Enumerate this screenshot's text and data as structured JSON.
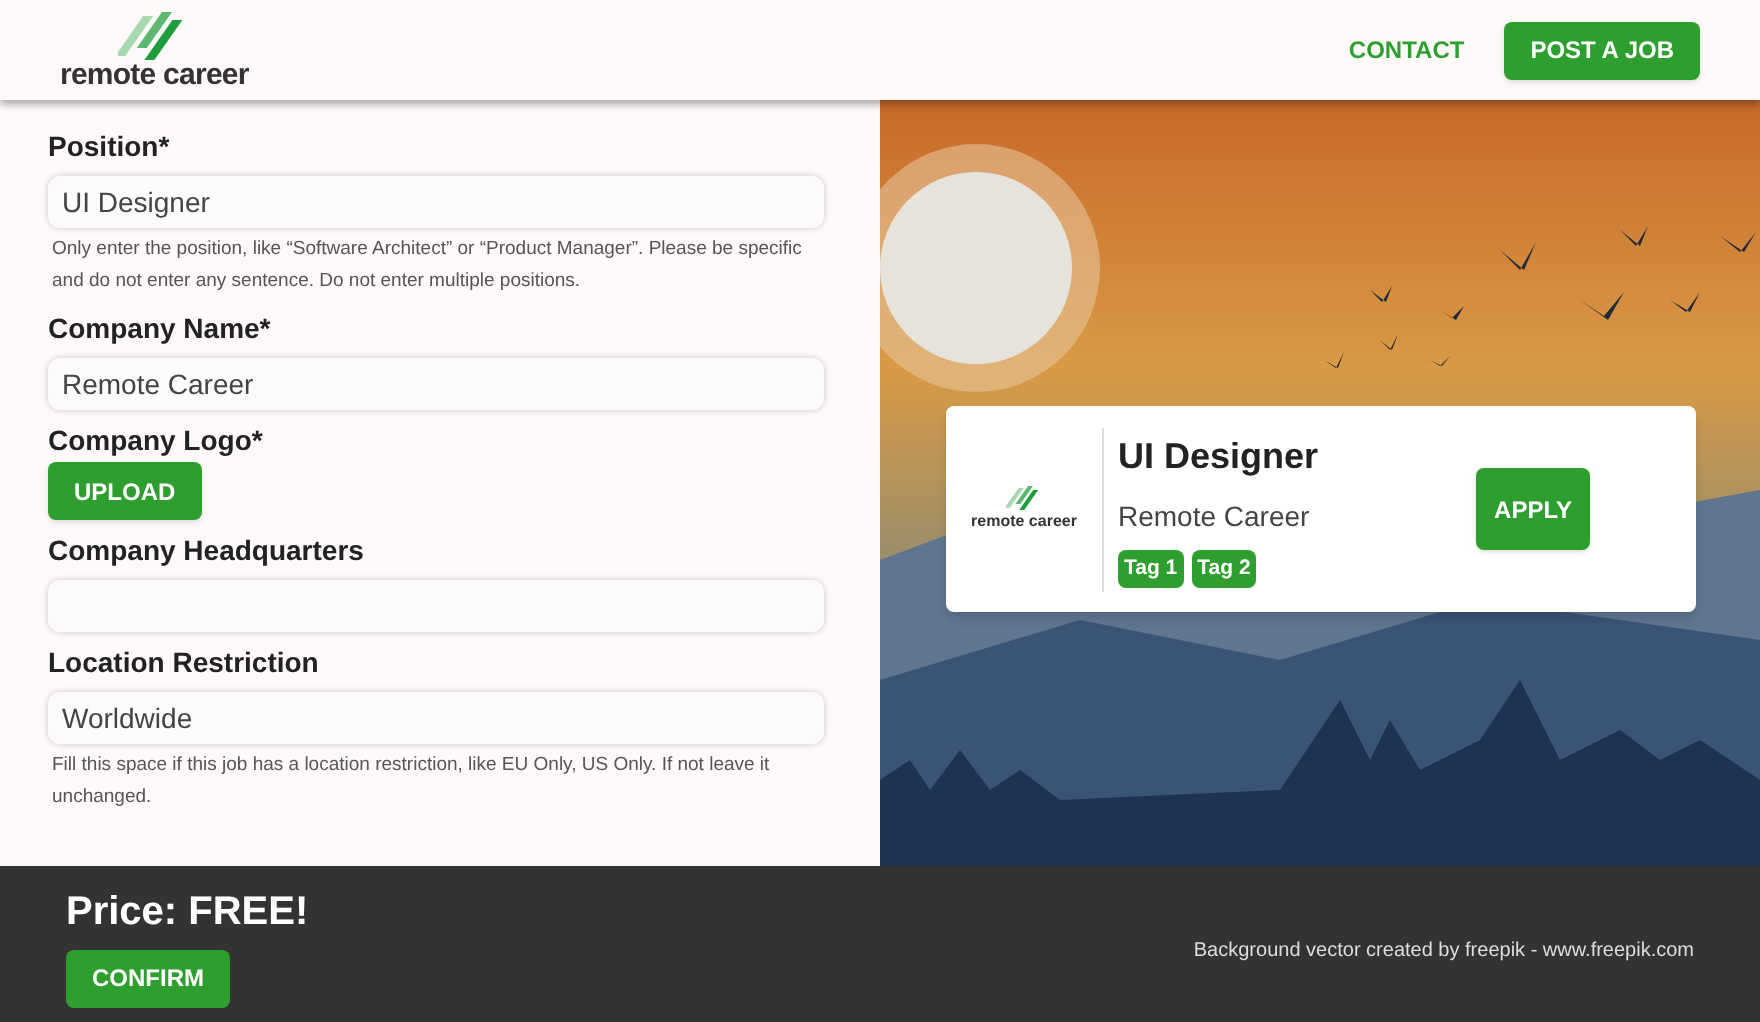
{
  "header": {
    "logo_text": "remote career",
    "nav": [
      {
        "label": "CONTACT",
        "kind": "link"
      },
      {
        "label": "POST A JOB",
        "kind": "button"
      }
    ]
  },
  "form": {
    "fields": [
      {
        "kind": "text",
        "label": "Position*",
        "value": "UI Designer",
        "help": "Only enter the position, like “Software Architect” or “Product Manager”. Please be specific and do not enter any sentence. Do not enter multiple positions."
      },
      {
        "kind": "text",
        "label": "Company Name*",
        "value": "Remote Career"
      },
      {
        "kind": "upload",
        "label": "Company Logo*",
        "button": "UPLOAD"
      },
      {
        "kind": "text",
        "label": "Company Headquarters"
      },
      {
        "kind": "text",
        "label": "Location Restriction",
        "value": "Worldwide",
        "help": "Fill this space if this job has a location restriction, like EU Only, US Only. If not leave it unchanged."
      }
    ]
  },
  "preview": {
    "logo_text": "remote career",
    "title": "UI Designer",
    "company": "Remote Career",
    "tags": [
      "Tag 1",
      "Tag 2"
    ],
    "button": "APPLY"
  },
  "footer": {
    "price": "Price: FREE!",
    "button": "CONFIRM",
    "credit": "Background vector created by freepik - www.freepik.com"
  }
}
